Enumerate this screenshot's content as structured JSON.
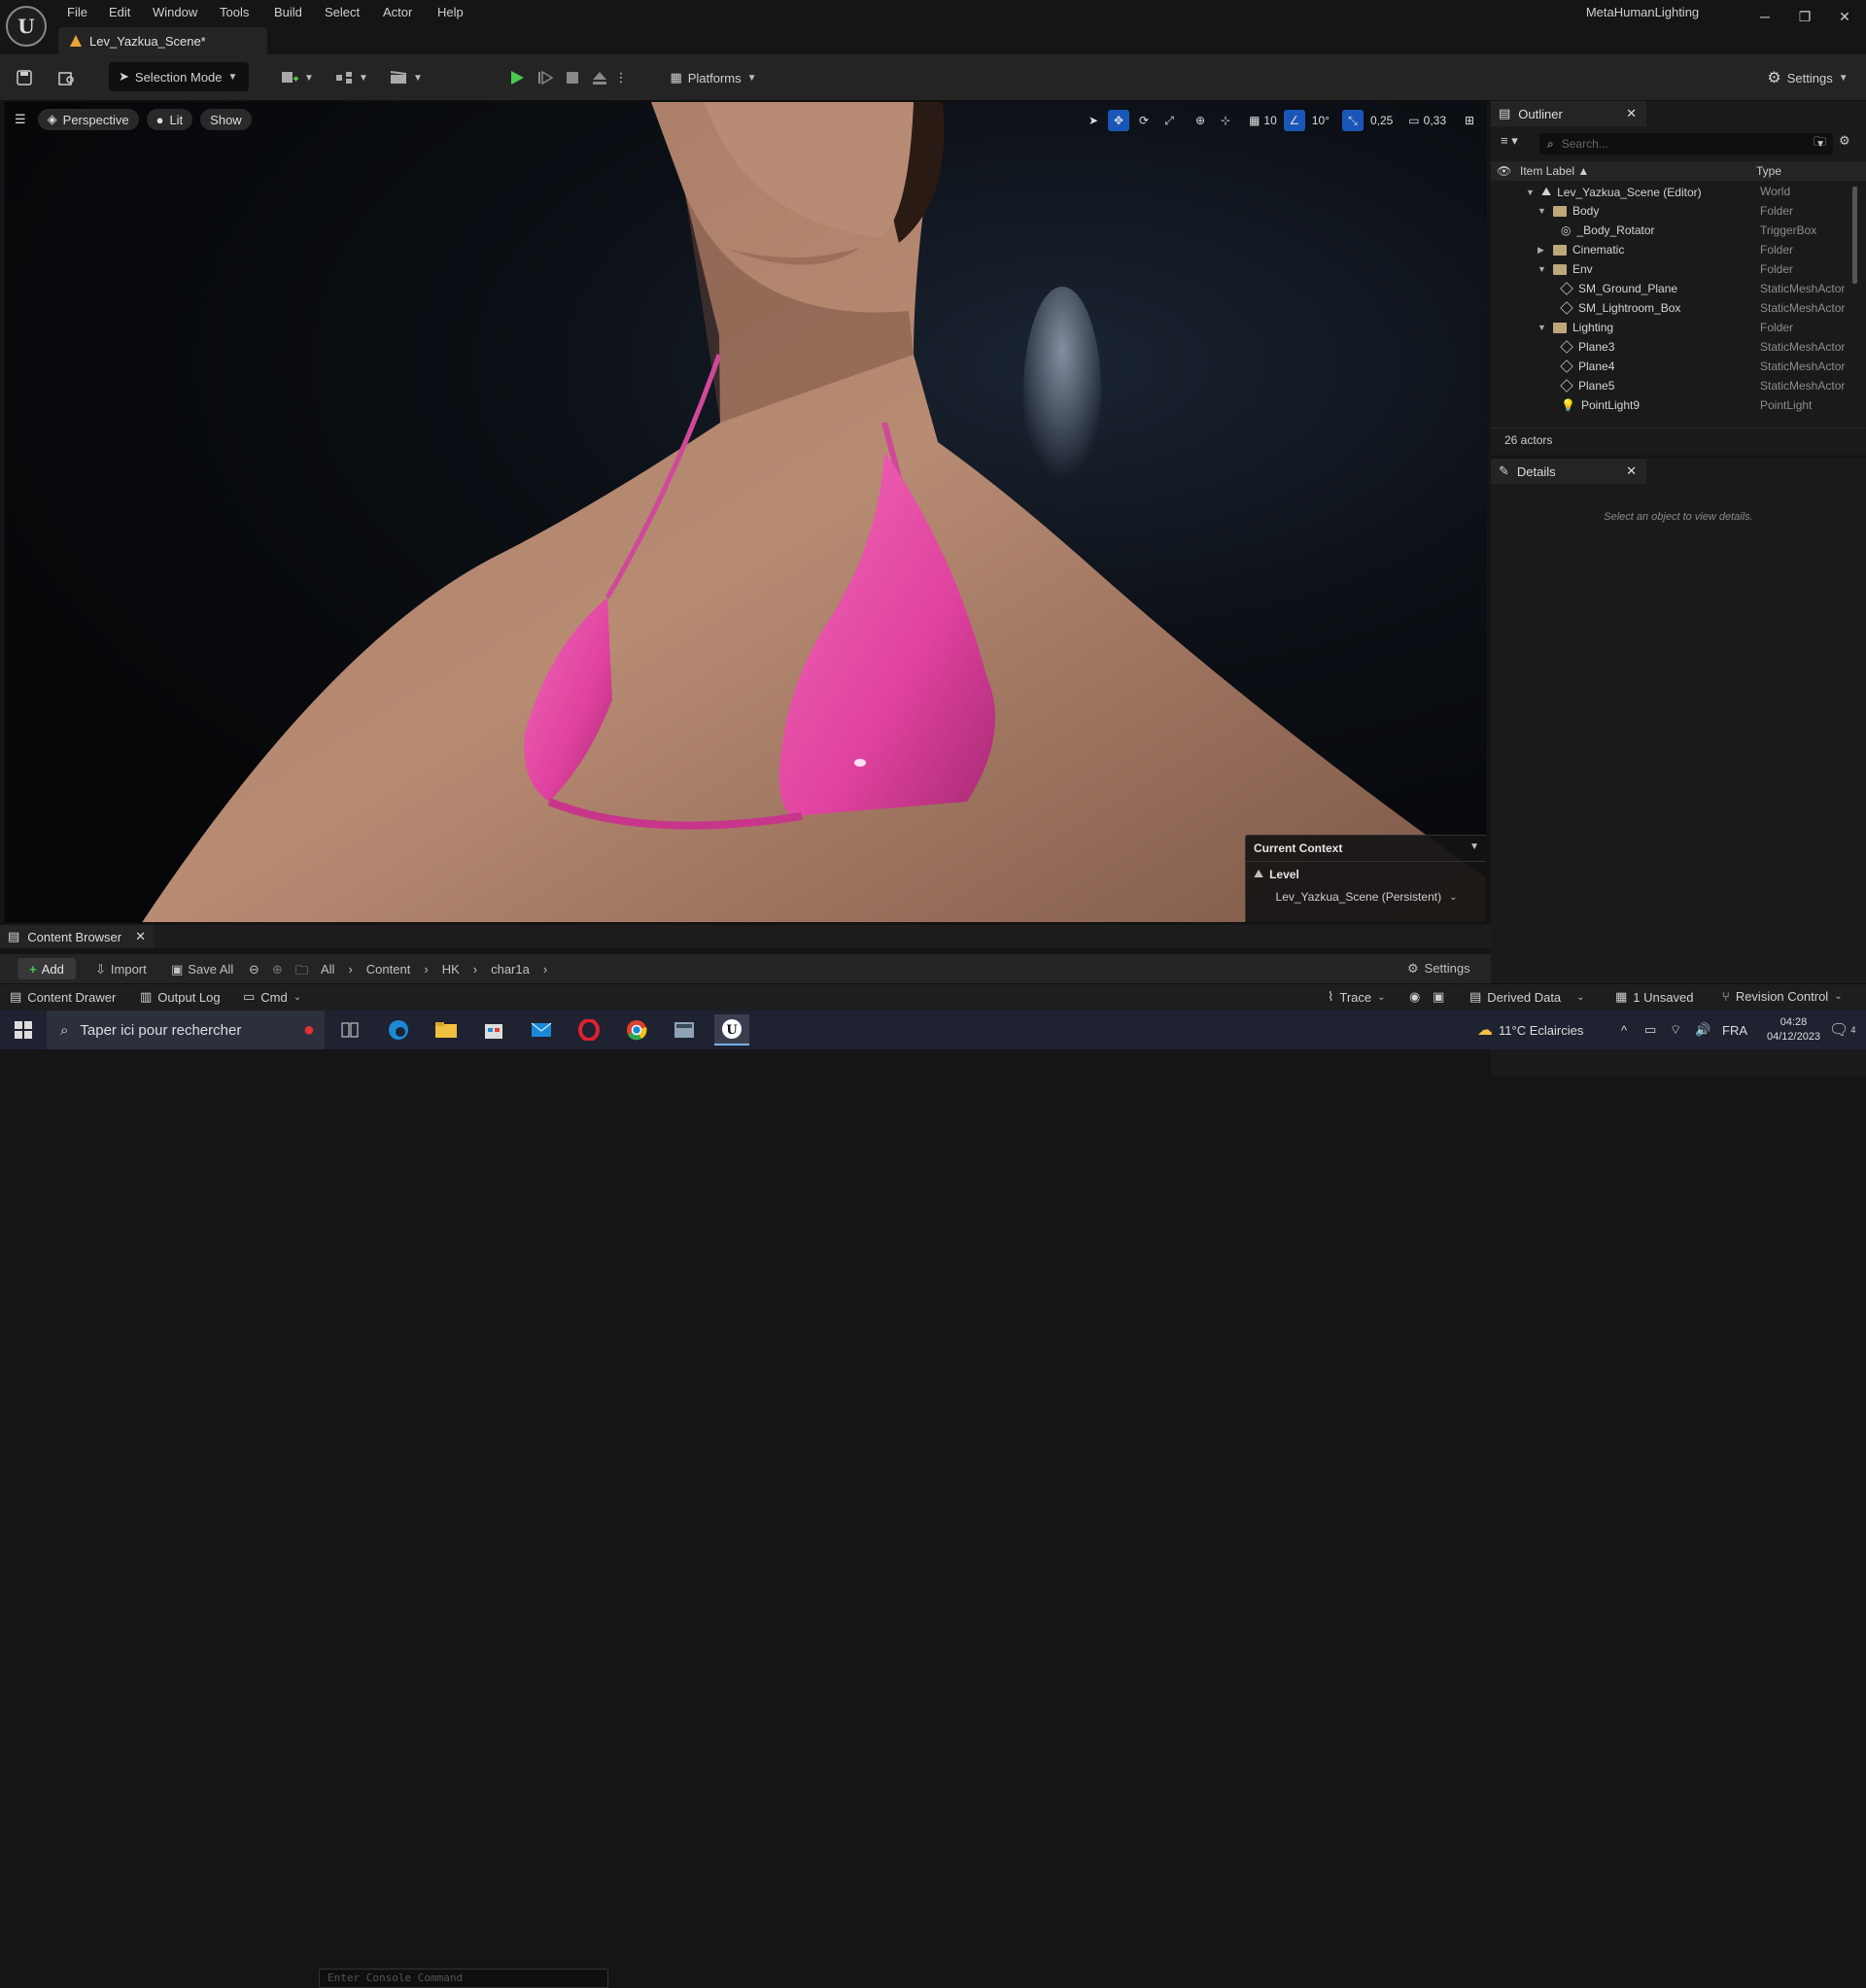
{
  "menu": [
    "File",
    "Edit",
    "Window",
    "Tools",
    "Build",
    "Select",
    "Actor",
    "Help"
  ],
  "project_name": "MetaHumanLighting",
  "doc_tab": "Lev_Yazkua_Scene*",
  "toolbar": {
    "selection_mode": "Selection Mode",
    "platforms": "Platforms",
    "settings": "Settings"
  },
  "viewport": {
    "perspective": "Perspective",
    "lit": "Lit",
    "show": "Show",
    "grid_snap": "10",
    "rotation_snap": "10°",
    "scale_snap": "0,25",
    "camera_speed": "0,33"
  },
  "current_context": {
    "title": "Current Context",
    "level_label": "Level",
    "level_value": "Lev_Yazkua_Scene (Persistent)"
  },
  "outliner": {
    "title": "Outliner",
    "search_placeholder": "Search...",
    "col_label": "Item Label ▲",
    "col_type": "Type",
    "actor_count": "26 actors",
    "rows": [
      {
        "label": "Lev_Yazkua_Scene (Editor)",
        "type": "World"
      },
      {
        "label": "Body",
        "type": "Folder"
      },
      {
        "label": "_Body_Rotator",
        "type": "TriggerBox"
      },
      {
        "label": "Cinematic",
        "type": "Folder"
      },
      {
        "label": "Env",
        "type": "Folder"
      },
      {
        "label": "SM_Ground_Plane",
        "type": "StaticMeshActor"
      },
      {
        "label": "SM_Lightroom_Box",
        "type": "StaticMeshActor"
      },
      {
        "label": "Lighting",
        "type": "Folder"
      },
      {
        "label": "Plane3",
        "type": "StaticMeshActor"
      },
      {
        "label": "Plane4",
        "type": "StaticMeshActor"
      },
      {
        "label": "Plane5",
        "type": "StaticMeshActor"
      },
      {
        "label": "PointLight9",
        "type": "PointLight"
      }
    ]
  },
  "details": {
    "title": "Details",
    "empty_text": "Select an object to view details."
  },
  "content_browser": {
    "title": "Content Browser",
    "add": "Add",
    "import": "Import",
    "save_all": "Save All",
    "breadcrumb": [
      "All",
      "Content",
      "HK",
      "char1a"
    ],
    "settings": "Settings"
  },
  "statusbar": {
    "content_drawer": "Content Drawer",
    "output_log": "Output Log",
    "cmd": "Cmd",
    "console_placeholder": "Enter Console Command",
    "trace": "Trace",
    "derived_data": "Derived Data",
    "unsaved": "1 Unsaved",
    "revision_control": "Revision Control"
  },
  "taskbar": {
    "search_placeholder": "Taper ici pour rechercher",
    "weather": "11°C  Eclaircies",
    "lang": "FRA",
    "time": "04:28",
    "date": "04/12/2023",
    "notif_count": "4"
  },
  "colors": {
    "accent_blue": "#1a56b8",
    "play_green": "#4cc94c",
    "bikini_pink": "#e0429f",
    "skin": "#b98c74"
  }
}
